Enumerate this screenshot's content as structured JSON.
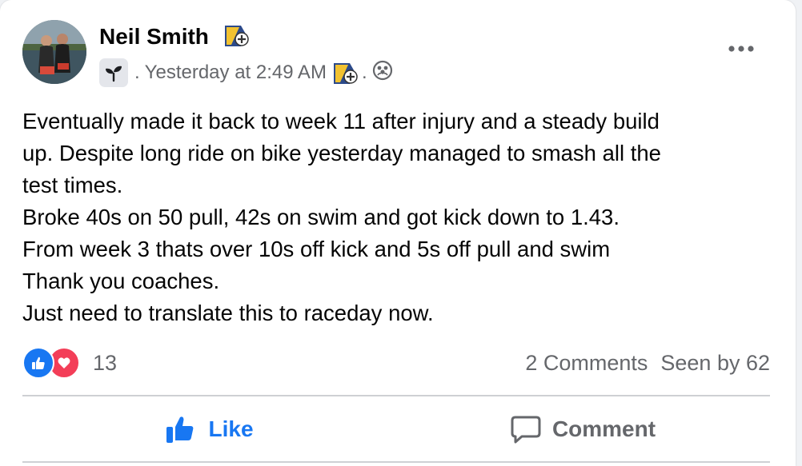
{
  "post": {
    "author": "Neil Smith",
    "timestamp": "Yesterday at 2:49 AM",
    "sep1": ".",
    "sep2": ".",
    "paragraphs": [
      "Eventually made it back to week  11 after injury and a steady build",
      "up. Despite long ride on bike yesterday managed to smash all the",
      "test times.",
      "Broke 40s on 50 pull, 42s on swim and got kick down to 1.43.",
      "From week 3 thats over 10s off kick and 5s off pull and swim",
      "Thank you coaches.",
      "Just need to translate this to raceday now."
    ]
  },
  "stats": {
    "reaction_count": "13",
    "comments": "2 Comments",
    "seen": "Seen by 62"
  },
  "actions": {
    "like_label": "Like",
    "comment_label": "Comment"
  },
  "icons": {
    "badge": "badge-icon",
    "group": "group-sprout-icon",
    "privacy": "group-privacy-icon",
    "more": "more-options-icon",
    "like": "thumbs-up-icon",
    "love": "heart-icon",
    "comment": "comment-bubble-icon"
  },
  "colors": {
    "accent": "#1877f2",
    "love": "#f33e58",
    "secondary_text": "#65676b",
    "primary_text": "#050505",
    "divider": "#ced0d4"
  }
}
